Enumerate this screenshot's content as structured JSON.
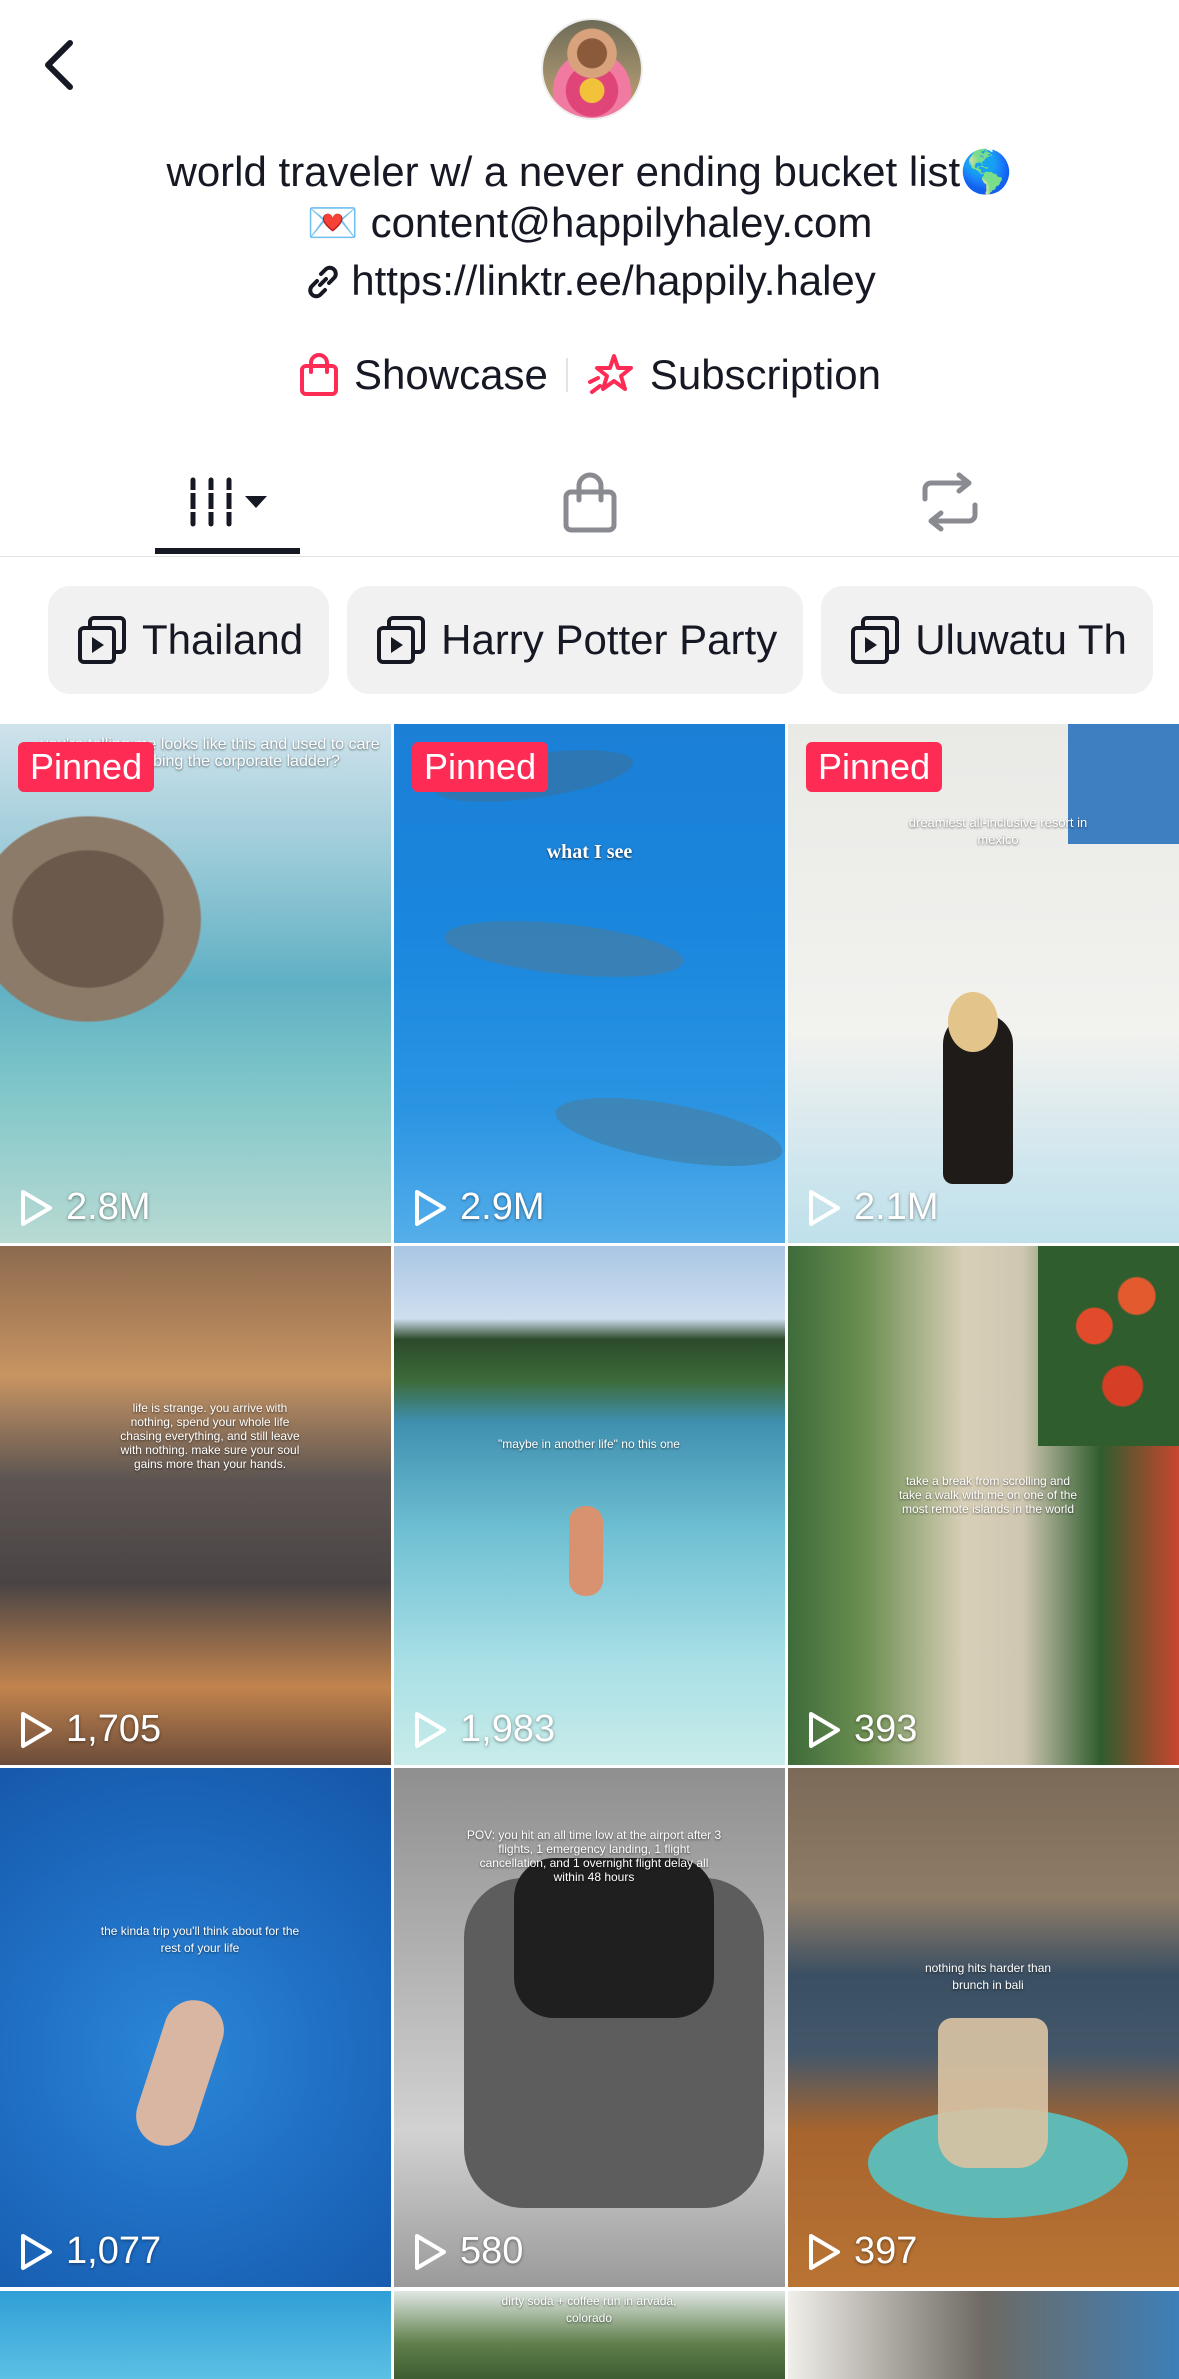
{
  "header": {
    "back_icon": "chevron-left-icon",
    "bio_line1": "world traveler w/ a never ending bucket list🌎",
    "bio_line2": "💌 content@happilyhaley.com",
    "link": "https://linktr.ee/happily.haley"
  },
  "actions": {
    "showcase": "Showcase",
    "subscription": "Subscription",
    "accent": "#fe2c55"
  },
  "tabs": {
    "videos_icon": "grid-icon",
    "shop_icon": "shopping-bag-icon",
    "reposts_icon": "repost-icon"
  },
  "playlists": [
    "Thailand",
    "Harry Potter Party",
    "Uluwatu Th"
  ],
  "videos": [
    {
      "pinned": "Pinned",
      "views": "2.8M",
      "caption": "you're telling me looks like this and used to care about climbing the corporate ladder?"
    },
    {
      "pinned": "Pinned",
      "views": "2.9M",
      "caption": "what I see"
    },
    {
      "pinned": "Pinned",
      "views": "2.1M",
      "caption": "dreamiest all-inclusive resort in mexico"
    },
    {
      "views": "1,705",
      "caption": "life is strange. you arrive with nothing, spend your whole life chasing everything, and still leave with nothing. make sure your soul gains more than your hands."
    },
    {
      "views": "1,983",
      "caption": "\"maybe in another life\" no this one"
    },
    {
      "views": "393",
      "caption": "take a break from scrolling and take a walk with me on one of the most remote islands in the world"
    },
    {
      "views": "1,077",
      "caption": "the kinda trip you'll think about for the rest of your life"
    },
    {
      "views": "580",
      "caption": "POV: you hit an all time low at the airport after 3 flights, 1 emergency landing, 1 flight cancellation, and 1 overnight flight delay all within 48 hours"
    },
    {
      "views": "397",
      "caption": "nothing hits harder than brunch in bali"
    }
  ],
  "partial_row": {
    "caption2": "dirty soda + coffee run in arvada, colorado"
  },
  "pinned_badge_color": "#fe2c55"
}
